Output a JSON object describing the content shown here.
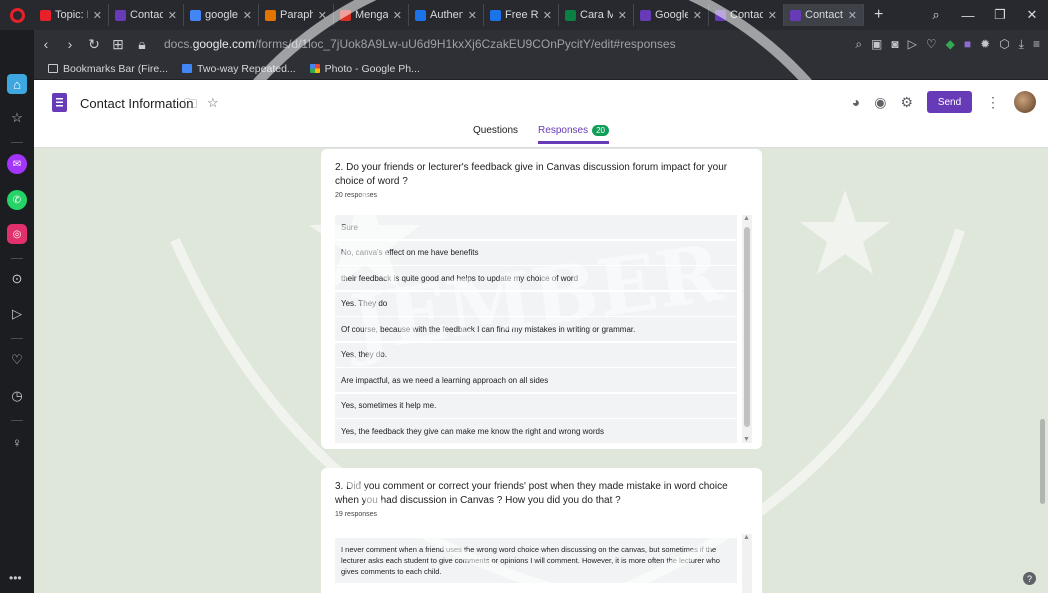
{
  "browser": {
    "tabs": [
      {
        "label": "Topic: Di",
        "color": "#e8202a",
        "active": false
      },
      {
        "label": "Contact",
        "color": "#673ab7",
        "active": false
      },
      {
        "label": "google",
        "color": "#4285f4",
        "active": false
      },
      {
        "label": "Paraphr",
        "color": "#e37400",
        "active": false
      },
      {
        "label": "Mengap",
        "color": "#d93025",
        "active": false
      },
      {
        "label": "Authenti",
        "color": "#1a73e8",
        "active": false
      },
      {
        "label": "Free Res",
        "color": "#1a73e8",
        "active": false
      },
      {
        "label": "Cara Me",
        "color": "#0b8043",
        "active": false
      },
      {
        "label": "Google",
        "color": "#673ab7",
        "active": false
      },
      {
        "label": "Contact",
        "color": "#673ab7",
        "active": false
      },
      {
        "label": "Contact",
        "color": "#673ab7",
        "active": true
      }
    ],
    "new_tab": "+",
    "url_prefix": "docs.",
    "url_domain": "google.com",
    "url_rest": "/forms/d/1loc_7jUok8A9Lw-uU6d9H1kxXj6CzakEU9COnPycitY/edit#responses",
    "bookmarks": [
      {
        "label": "Bookmarks Bar (Fire..."
      },
      {
        "label": "Two-way Repeated..."
      },
      {
        "label": "Photo - Google Ph..."
      }
    ]
  },
  "form": {
    "title": "Contact Information",
    "send_label": "Send",
    "tabs": {
      "questions": "Questions",
      "responses": "Responses",
      "responses_count": "20"
    }
  },
  "questions": [
    {
      "text": "2. Do your friends or lecturer's feedback give in Canvas discussion forum impact for your choice of word ?",
      "count": "20 responses",
      "answers": [
        "Sure",
        "No, canva's effect on me have benefits",
        "their feedback is quite good and helps to update my choice of word",
        "Yes. They do",
        "Of course, because with the feedback I can find my mistakes in writing or grammar.",
        "Yes, they do.",
        "Are impactful, as we need a learning approach on all sides",
        "Yes, sometimes it help me.",
        "Yes, the feedback they give can make me know the right and wrong words"
      ]
    },
    {
      "text": "3. Did you comment or correct your friends' post when they made mistake in word choice when you had discussion in Canvas ? How you did you do that ?",
      "count": "19 responses",
      "answers": [
        "I never comment when a friend uses the wrong word choice when discussing on the canvas, but sometimes if the lecturer asks each student to give comments or opinions I will comment. However, it is more often the lecturer who gives comments to each child."
      ]
    }
  ],
  "watermark": {
    "text": "JEMBER"
  }
}
